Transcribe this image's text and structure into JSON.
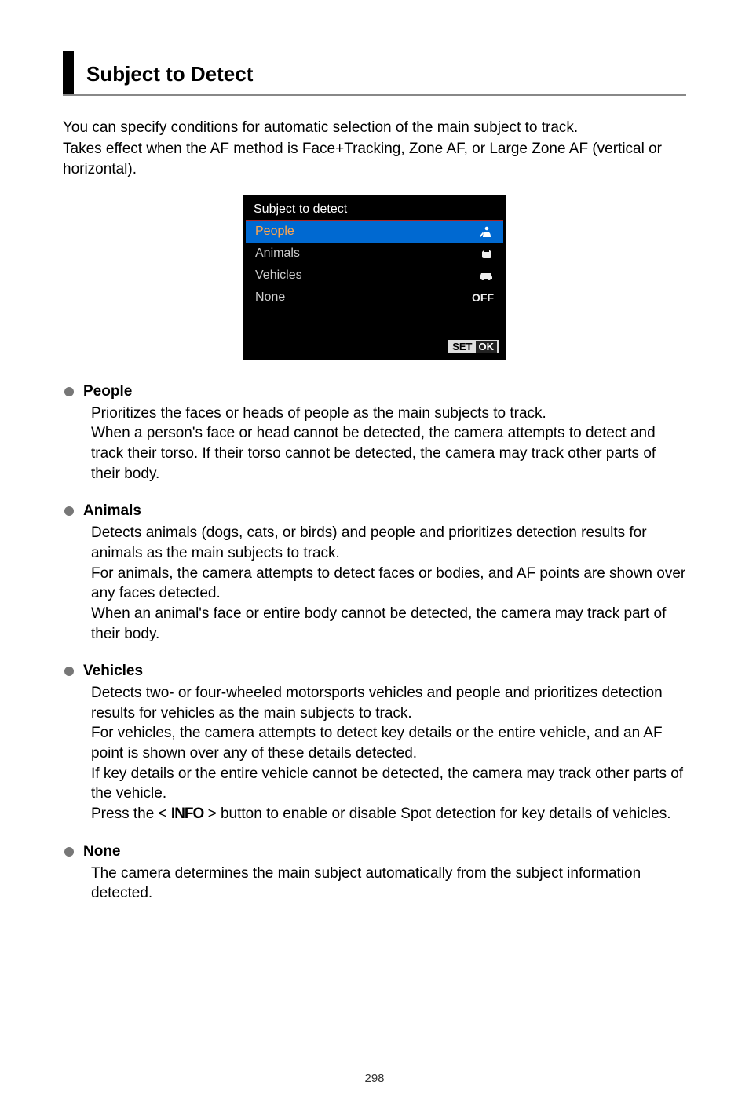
{
  "heading": "Subject to Detect",
  "intro": "You can specify conditions for automatic selection of the main subject to track.\nTakes effect when the AF method is Face+Tracking, Zone AF, or Large Zone AF (vertical or horizontal).",
  "screenshot": {
    "title": "Subject to detect",
    "rows": [
      {
        "label": "People",
        "value_icon": "person-icon",
        "selected": true
      },
      {
        "label": "Animals",
        "value_icon": "animal-icon",
        "selected": false
      },
      {
        "label": "Vehicles",
        "value_icon": "vehicle-icon",
        "selected": false
      },
      {
        "label": "None",
        "value_text": "OFF",
        "selected": false
      }
    ],
    "set": "SET",
    "ok": "OK"
  },
  "sections": [
    {
      "title": "People",
      "body": "Prioritizes the faces or heads of people as the main subjects to track.\nWhen a person's face or head cannot be detected, the camera attempts to detect and track their torso. If their torso cannot be detected, the camera may track other parts of their body."
    },
    {
      "title": "Animals",
      "body": "Detects animals (dogs, cats, or birds) and people and prioritizes detection results for animals as the main subjects to track.\nFor animals, the camera attempts to detect faces or bodies, and AF points are shown over any faces detected.\nWhen an animal's face or entire body cannot be detected, the camera may track part of their body."
    },
    {
      "title": "Vehicles",
      "body_pre": "Detects two- or four-wheeled motorsports vehicles and people and prioritizes detection results for vehicles as the main subjects to track.\nFor vehicles, the camera attempts to detect key details or the entire vehicle, and an AF point is shown over any of these details detected.\nIf key details or the entire vehicle cannot be detected, the camera may track other parts of the vehicle.\nPress the < ",
      "info_label": "INFO",
      "body_post": " > button to enable or disable Spot detection for key details of vehicles."
    },
    {
      "title": "None",
      "body": "The camera determines the main subject automatically from the subject information detected."
    }
  ],
  "page": "298"
}
